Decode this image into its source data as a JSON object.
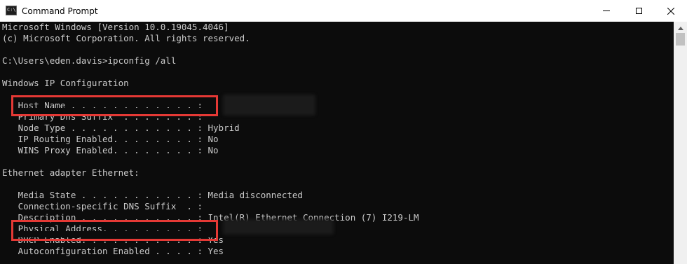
{
  "window": {
    "title": "Command Prompt",
    "icon": "cmd-app-icon",
    "icon_text": "C:\\",
    "controls": [
      "minimize",
      "maximize",
      "close"
    ]
  },
  "console": {
    "lines": [
      "Microsoft Windows [Version 10.0.19045.4046]",
      "(c) Microsoft Corporation. All rights reserved.",
      "",
      "C:\\Users\\eden.davis>ipconfig /all",
      "",
      "Windows IP Configuration",
      "",
      "   Host Name . . . . . . . . . . . . :",
      "   Primary Dns Suffix  . . . . . . . :",
      "   Node Type . . . . . . . . . . . . : Hybrid",
      "   IP Routing Enabled. . . . . . . . : No",
      "   WINS Proxy Enabled. . . . . . . . : No",
      "",
      "Ethernet adapter Ethernet:",
      "",
      "   Media State . . . . . . . . . . . : Media disconnected",
      "   Connection-specific DNS Suffix  . :",
      "   Description . . . . . . . . . . . : Intel(R) Ethernet Connection (7) I219-LM",
      "   Physical Address. . . . . . . . . :",
      "   DHCP Enabled. . . . . . . . . . . : Yes",
      "   Autoconfiguration Enabled . . . . : Yes"
    ]
  },
  "annotations": {
    "highlights": [
      "Host Name",
      "Physical Address"
    ],
    "highlight_color": "#e53935",
    "redacted_values": [
      "Host Name",
      "Physical Address"
    ]
  },
  "colors": {
    "console_bg": "#0c0c0c",
    "console_text": "#cccccc",
    "titlebar_bg": "#ffffff"
  }
}
